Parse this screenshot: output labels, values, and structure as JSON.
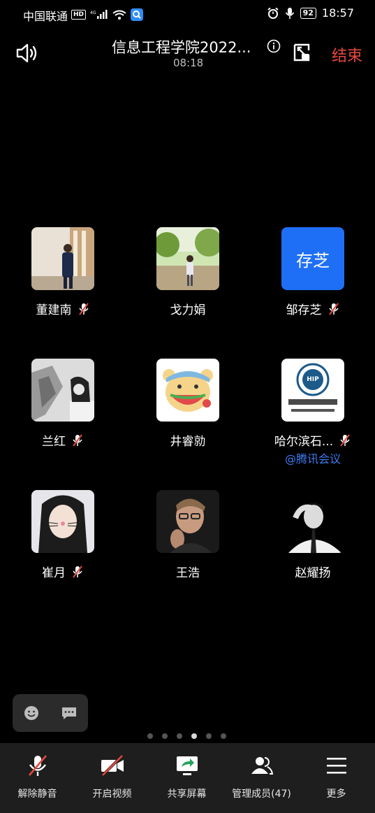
{
  "status_bar": {
    "carrier": "中国联通",
    "hd": "HD",
    "network": "4G",
    "battery": "92",
    "time": "18:57"
  },
  "header": {
    "title": "信息工程学院2022...",
    "timer": "08:18",
    "end_label": "结束"
  },
  "participants": [
    {
      "name": "董建南",
      "muted": true,
      "avatar": "photo"
    },
    {
      "name": "戈力娟",
      "muted": false,
      "avatar": "photo"
    },
    {
      "name": "邹存芝",
      "muted": true,
      "avatar": "text",
      "avatar_text": "存芝"
    },
    {
      "name": "兰红",
      "muted": true,
      "avatar": "photo"
    },
    {
      "name": "井睿勍",
      "muted": false,
      "avatar": "cartoon"
    },
    {
      "name": "哈尔滨石...",
      "muted": true,
      "avatar": "logo",
      "sub": "@腾讯会议"
    },
    {
      "name": "崔月",
      "muted": true,
      "avatar": "photo"
    },
    {
      "name": "王浩",
      "muted": false,
      "avatar": "photo"
    },
    {
      "name": "赵耀扬",
      "muted": false,
      "avatar": "photo"
    }
  ],
  "pagination": {
    "total": 6,
    "current": 4
  },
  "toolbar": {
    "unmute": "解除静音",
    "video": "开启视频",
    "share": "共享屏幕",
    "members": "管理成员(47)",
    "more": "更多"
  },
  "colors": {
    "end": "#e5483f",
    "accent_blue": "#1f6ff6",
    "link_blue": "#3d7bf2",
    "mute_red": "#e5483f"
  }
}
